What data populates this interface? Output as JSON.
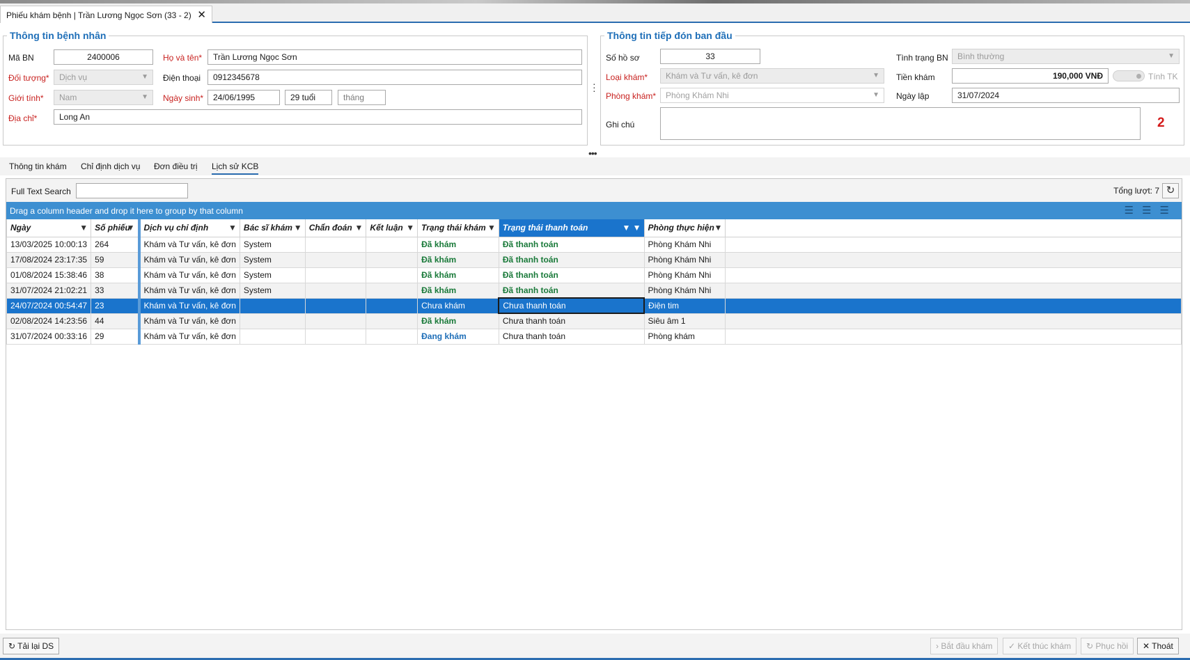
{
  "window": {
    "tab_title": "Phiếu khám bệnh | Trần Lương Ngọc Sơn (33 - 2)",
    "close_glyph": "✕"
  },
  "patient": {
    "legend": "Thông tin bệnh nhân",
    "ma_bn_label": "Mã BN",
    "ma_bn": "2400006",
    "ho_ten_label": "Họ và tên*",
    "ho_ten": "Trần Lương Ngọc Sơn",
    "doi_tuong_label": "Đối tượng*",
    "doi_tuong": "Dịch vụ",
    "dien_thoai_label": "Điện thoại",
    "dien_thoai": "0912345678",
    "gioi_tinh_label": "Giới tính*",
    "gioi_tinh": "Nam",
    "ngay_sinh_label": "Ngày sinh*",
    "ngay_sinh": "24/06/1995",
    "tuoi": "29 tuổi",
    "thang_placeholder": "tháng",
    "dia_chi_label": "Địa chỉ*",
    "dia_chi": "Long An"
  },
  "reception": {
    "legend": "Thông tin tiếp đón ban đầu",
    "so_ho_so_label": "Số hồ sơ",
    "so_ho_so": "33",
    "tinh_trang_label": "Tình trạng BN",
    "tinh_trang": "Bình thường",
    "loai_kham_label": "Loại khám*",
    "loai_kham": "Khám và Tư vấn, kê đơn",
    "tien_kham_label": "Tiền khám",
    "tien_kham": "190,000 VNĐ",
    "tinh_tk_label": "Tính TK",
    "phong_kham_label": "Phòng khám*",
    "phong_kham": "Phòng Khám Nhi",
    "ngay_lap_label": "Ngày lập",
    "ngay_lap": "31/07/2024",
    "ghi_chu_label": "Ghi chú",
    "ghi_chu": "",
    "badge_number": "2"
  },
  "subtabs": [
    "Thông tin khám",
    "Chỉ định dịch vụ",
    "Đơn điều trị",
    "Lịch sử KCB"
  ],
  "active_subtab": 3,
  "grid": {
    "search_label": "Full Text Search",
    "search_value": "",
    "total_label": "Tổng lượt: 7",
    "group_hint": "Drag a column header and drop it here to group by that column",
    "columns": [
      "Ngày",
      "Số phiếu",
      "Dịch vụ chỉ định",
      "Bác sĩ khám",
      "Chẩn đoán",
      "Kết luận",
      "Trạng thái khám",
      "Trạng thái thanh toán",
      "Phòng thực hiện"
    ],
    "rows": [
      [
        "13/03/2025 10:00:13",
        "264",
        "Khám và Tư vấn, kê đơn",
        "System",
        "",
        "",
        "Đã khám",
        "Đã thanh toán",
        "Phòng Khám Nhi"
      ],
      [
        "17/08/2024 23:17:35",
        "59",
        "Khám và Tư vấn, kê đơn",
        "System",
        "",
        "",
        "Đã khám",
        "Đã thanh toán",
        "Phòng Khám Nhi"
      ],
      [
        "01/08/2024 15:38:46",
        "38",
        "Khám và Tư vấn, kê đơn",
        "System",
        "",
        "",
        "Đã khám",
        "Đã thanh toán",
        "Phòng Khám Nhi"
      ],
      [
        "31/07/2024 21:02:21",
        "33",
        "Khám và Tư vấn, kê đơn",
        "System",
        "",
        "",
        "Đã khám",
        "Đã thanh toán",
        "Phòng Khám Nhi"
      ],
      [
        "24/07/2024 00:54:47",
        "23",
        "Khám và Tư vấn, kê đơn",
        "",
        "",
        "",
        "Chưa khám",
        "Chưa thanh toán",
        "Điện tim"
      ],
      [
        "02/08/2024 14:23:56",
        "44",
        "Khám và Tư vấn, kê đơn",
        "",
        "",
        "",
        "Đã khám",
        "Chưa thanh toán",
        "Siêu âm 1"
      ],
      [
        "31/07/2024 00:33:16",
        "29",
        "Khám và Tư vấn, kê đơn",
        "",
        "",
        "",
        "Đang khám",
        "Chưa thanh toán",
        "Phòng khám"
      ]
    ],
    "selected_row": 4
  },
  "bottom": {
    "reload": "Tải lại DS",
    "start": "Bắt đầu khám",
    "finish": "Kết thúc khám",
    "restore": "Phục hồi",
    "exit": "Thoát"
  },
  "colors": {
    "accent": "#1a74cc",
    "group_bar": "#3d8fd1",
    "required": "#c8211f",
    "done": "#1a7a3a"
  }
}
